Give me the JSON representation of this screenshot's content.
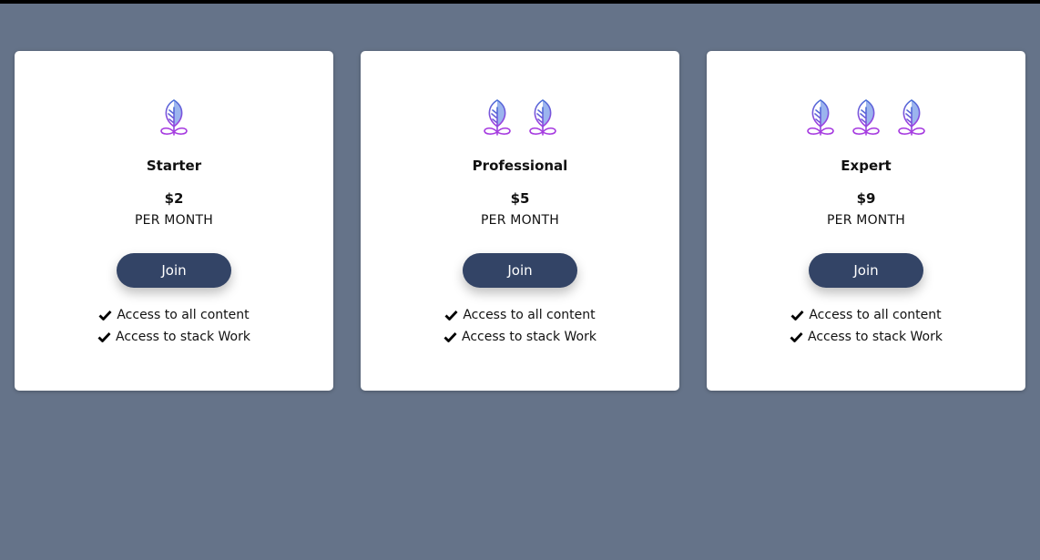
{
  "colors": {
    "background": "#657389",
    "card": "#ffffff",
    "button": "#334466",
    "leaf_gradient_start": "#4a6fd6",
    "leaf_gradient_end": "#a63be0",
    "leaf_fill": "#9bb4ee"
  },
  "plans": [
    {
      "icon": "leaf-icon",
      "icon_count": 1,
      "name": "Starter",
      "price": "$2",
      "period": "PER MONTH",
      "button_label": "Join",
      "features": [
        "Access to all content",
        "Access to stack Work"
      ]
    },
    {
      "icon": "leaf-icon",
      "icon_count": 2,
      "name": "Professional",
      "price": "$5",
      "period": "PER MONTH",
      "button_label": "Join",
      "features": [
        "Access to all content",
        "Access to stack Work"
      ]
    },
    {
      "icon": "leaf-icon",
      "icon_count": 3,
      "name": "Expert",
      "price": "$9",
      "period": "PER MONTH",
      "button_label": "Join",
      "features": [
        "Access to all content",
        "Access to stack Work"
      ]
    }
  ],
  "feature_icon": "check-icon"
}
